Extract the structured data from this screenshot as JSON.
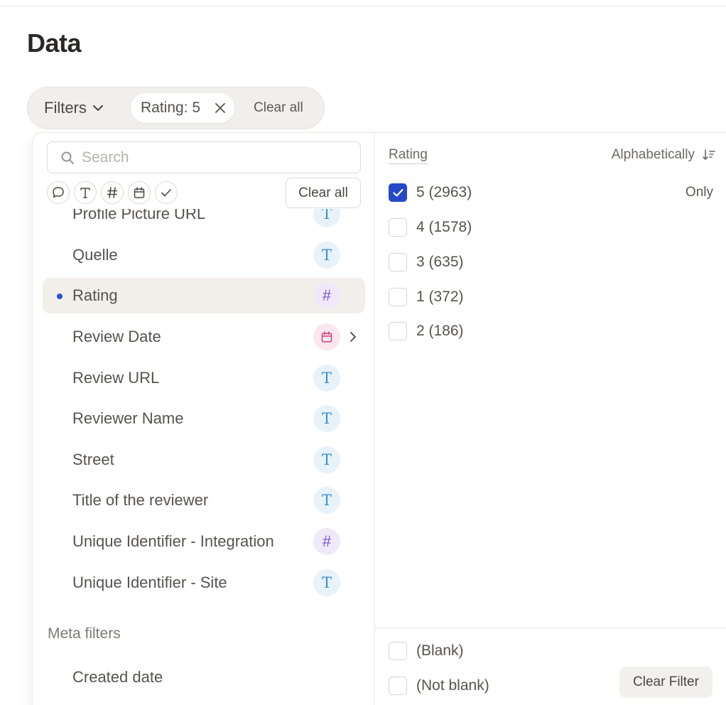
{
  "page": {
    "title": "Data"
  },
  "filter_bar": {
    "filters_label": "Filters",
    "chip_label": "Rating: 5",
    "clear_all": "Clear all"
  },
  "panel": {
    "search_placeholder": "Search",
    "type_icons": [
      "comment-icon",
      "text-icon",
      "hash-icon",
      "calendar-icon",
      "check-icon"
    ],
    "clear_all": "Clear all",
    "fields": [
      {
        "label": "Profile Picture URL",
        "type": "text"
      },
      {
        "label": "Quelle",
        "type": "text"
      },
      {
        "label": "Rating",
        "type": "number",
        "active": true
      },
      {
        "label": "Review Date",
        "type": "date"
      },
      {
        "label": "Review URL",
        "type": "text"
      },
      {
        "label": "Reviewer Name",
        "type": "text"
      },
      {
        "label": "Street",
        "type": "text"
      },
      {
        "label": "Title of the reviewer",
        "type": "text"
      },
      {
        "label": "Unique Identifier - Integration",
        "type": "number"
      },
      {
        "label": "Unique Identifier - Site",
        "type": "text"
      }
    ],
    "meta_section": "Meta filters",
    "meta_fields": [
      {
        "label": "Created date"
      }
    ]
  },
  "values_pane": {
    "header": "Rating",
    "sort_label": "Alphabetically",
    "options": [
      {
        "label": "5 (2963)",
        "checked": true
      },
      {
        "label": "4 (1578)",
        "checked": false
      },
      {
        "label": "3 (635)",
        "checked": false
      },
      {
        "label": "1 (372)",
        "checked": false
      },
      {
        "label": "2 (186)",
        "checked": false
      }
    ],
    "only_label": "Only",
    "blank_label": "(Blank)",
    "not_blank_label": "(Not blank)",
    "clear_filter": "Clear Filter"
  },
  "colors": {
    "accent": "#2549c9",
    "text_badge": "#3d8fd1",
    "number_badge": "#7b56d4",
    "date_badge": "#d7437c"
  }
}
